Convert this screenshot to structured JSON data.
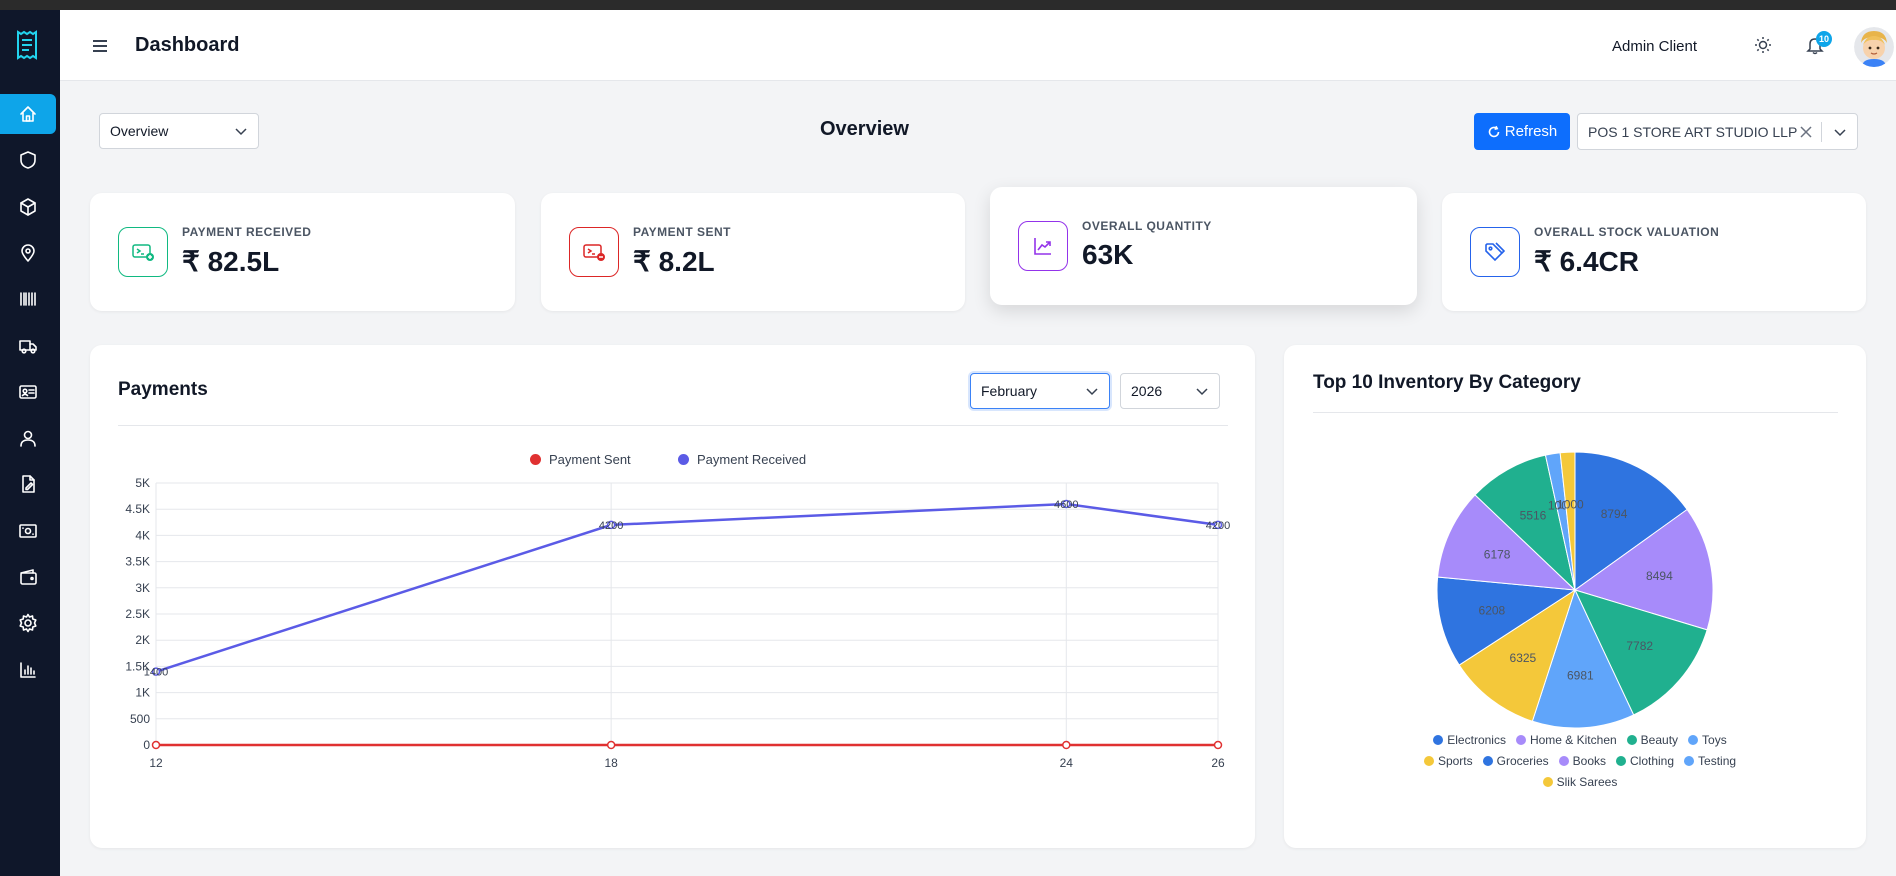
{
  "header": {
    "title": "Dashboard",
    "user_name": "Admin Client",
    "notification_count": "10"
  },
  "toolbar": {
    "view_select": "Overview",
    "section_title": "Overview",
    "refresh_label": "Refresh",
    "store_select": "POS 1 STORE ART STUDIO LLP"
  },
  "stats": [
    {
      "label": "PAYMENT RECEIVED",
      "value": "₹ 82.5L",
      "icon": "money-in-icon",
      "color": "#10b981"
    },
    {
      "label": "PAYMENT SENT",
      "value": "₹ 8.2L",
      "icon": "money-out-icon",
      "color": "#dc2626"
    },
    {
      "label": "OVERALL QUANTITY",
      "value": "63K",
      "icon": "trend-up-icon",
      "color": "#9333ea"
    },
    {
      "label": "OVERALL STOCK VALUATION",
      "value": "₹ 6.4CR",
      "icon": "tag-icon",
      "color": "#2563eb"
    }
  ],
  "sidebar": {
    "items": [
      {
        "icon": "home-icon",
        "active": true
      },
      {
        "icon": "shield-icon",
        "active": false
      },
      {
        "icon": "box-icon",
        "active": false
      },
      {
        "icon": "map-pin-icon",
        "active": false
      },
      {
        "icon": "barcode-icon",
        "active": false
      },
      {
        "icon": "truck-icon",
        "active": false
      },
      {
        "icon": "id-card-icon",
        "active": false
      },
      {
        "icon": "user-icon",
        "active": false
      },
      {
        "icon": "file-edit-icon",
        "active": false
      },
      {
        "icon": "cash-icon",
        "active": false
      },
      {
        "icon": "wallet-icon",
        "active": false
      },
      {
        "icon": "settings-icon",
        "active": false
      },
      {
        "icon": "bar-chart-icon",
        "active": false
      }
    ]
  },
  "payments": {
    "title": "Payments",
    "month": "February",
    "year": "2026"
  },
  "inventory": {
    "title": "Top 10 Inventory By Category"
  },
  "chart_data": [
    {
      "type": "line",
      "title": "Payments",
      "x": [
        12,
        18,
        24,
        26
      ],
      "series": [
        {
          "name": "Payment Sent",
          "color": "#e03131",
          "values": [
            0,
            0,
            0,
            0
          ]
        },
        {
          "name": "Payment Received",
          "color": "#5b5be6",
          "values": [
            1400,
            4200,
            4600,
            4200
          ]
        }
      ],
      "point_labels": [
        "1400",
        "4200",
        "4600",
        "4200"
      ],
      "y_ticks": [
        "0",
        "500",
        "1K",
        "1.5K",
        "2K",
        "2.5K",
        "3K",
        "3.5K",
        "4K",
        "4.5K",
        "5K"
      ],
      "ylim": [
        0,
        5000
      ],
      "grid": true,
      "legend": "top"
    },
    {
      "type": "pie",
      "title": "Top 10 Inventory By Category",
      "slices": [
        {
          "label": "Electronics",
          "value": 8794,
          "color": "#2f74e0"
        },
        {
          "label": "Home & Kitchen",
          "value": 8494,
          "color": "#a78bfa"
        },
        {
          "label": "Beauty",
          "value": 7782,
          "color": "#20b08f"
        },
        {
          "label": "Toys",
          "value": 6981,
          "color": "#60a5fa"
        },
        {
          "label": "Sports",
          "value": 6325,
          "color": "#f4c83a"
        },
        {
          "label": "Groceries",
          "value": 6208,
          "color": "#2f74e0"
        },
        {
          "label": "Books",
          "value": 6178,
          "color": "#a78bfa"
        },
        {
          "label": "Clothing",
          "value": 5516,
          "color": "#20b08f"
        },
        {
          "label": "Testing",
          "value": 1000,
          "color": "#60a5fa"
        },
        {
          "label": "Slik Sarees",
          "value": 1000,
          "color": "#f4c83a"
        }
      ],
      "legend": "bottom"
    }
  ]
}
